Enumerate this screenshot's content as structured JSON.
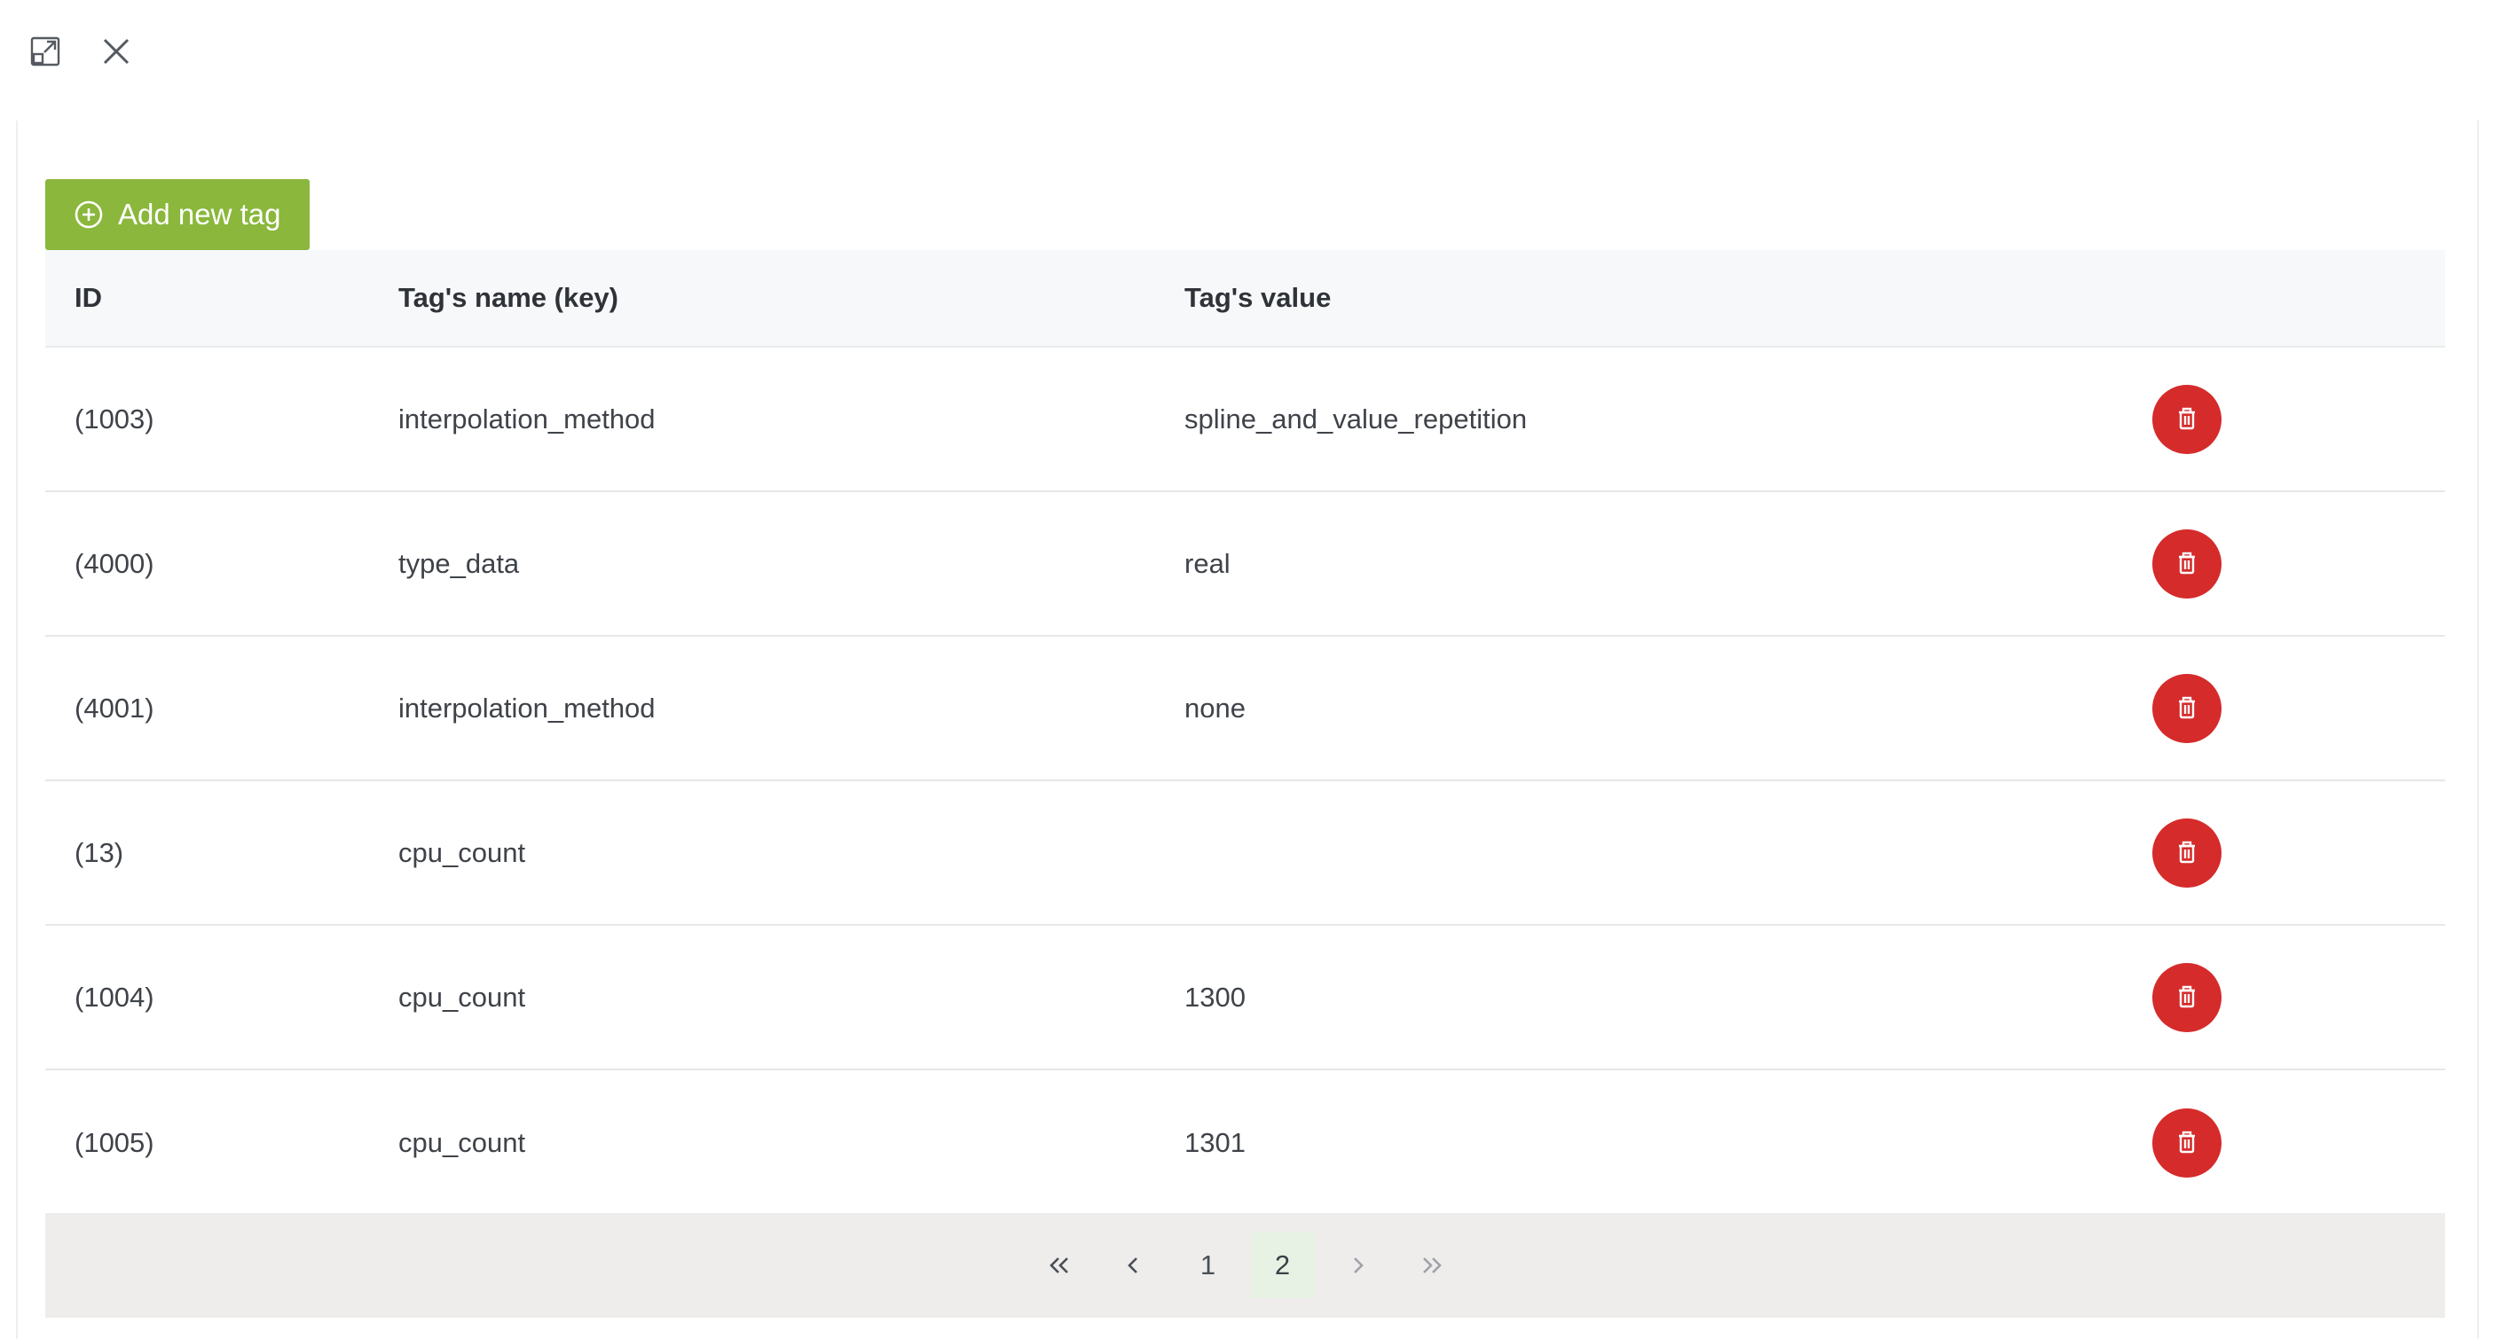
{
  "window": {
    "expand_icon": "expand-icon",
    "close_icon": "close-icon"
  },
  "toolbar": {
    "add_label": "Add new tag",
    "add_icon": "plus-circle-icon"
  },
  "table": {
    "headers": {
      "id": "ID",
      "name": "Tag's name (key)",
      "value": "Tag's value"
    },
    "rows": [
      {
        "id": "(1003)",
        "name": "interpolation_method",
        "value": "spline_and_value_repetition"
      },
      {
        "id": "(4000)",
        "name": "type_data",
        "value": "real"
      },
      {
        "id": "(4001)",
        "name": "interpolation_method",
        "value": "none"
      },
      {
        "id": "(13)",
        "name": "cpu_count",
        "value": ""
      },
      {
        "id": "(1004)",
        "name": "cpu_count",
        "value": "1300"
      },
      {
        "id": "(1005)",
        "name": "cpu_count",
        "value": "1301"
      }
    ],
    "delete_icon": "trash-icon"
  },
  "pagination": {
    "first_icon": "double-chevron-left-icon",
    "prev_icon": "chevron-left-icon",
    "pages": [
      "1",
      "2"
    ],
    "current_page": "2",
    "next_icon": "chevron-right-icon",
    "last_icon": "double-chevron-right-icon"
  },
  "colors": {
    "add_button": "#8ab73c",
    "delete_button": "#d52b2b",
    "active_page_bg": "#e7f2e5"
  }
}
